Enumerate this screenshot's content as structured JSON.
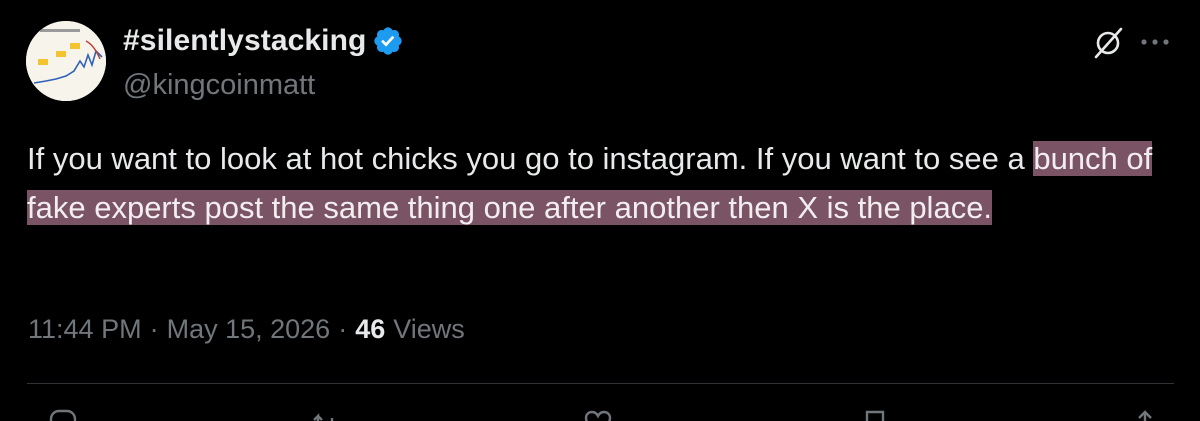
{
  "author": {
    "display_name": "#silentlystacking",
    "handle": "@kingcoinmatt",
    "verified": true,
    "avatar_icon": "bitcoin-price-history-chart-avatar"
  },
  "tweet": {
    "text_plain": "If you want to look at hot chicks you go to instagram. If you want to see a ",
    "text_highlighted": "bunch of fake experts post the same thing one after another then X is the place."
  },
  "meta": {
    "time": "11:44 PM",
    "separator": "·",
    "date": "May 15, 2026",
    "views_count": "46",
    "views_label": "Views"
  },
  "icons": {
    "grok": "grok-icon",
    "more": "more-icon",
    "reply": "reply-icon",
    "repost": "repost-icon",
    "like": "heart-icon",
    "bookmark": "bookmark-icon",
    "share": "share-icon"
  },
  "colors": {
    "background": "#000000",
    "text_primary": "#e7e9ea",
    "text_secondary": "#71767b",
    "verified": "#1d9bf0",
    "highlight": "#7a5465",
    "divider": "#2f3336"
  }
}
